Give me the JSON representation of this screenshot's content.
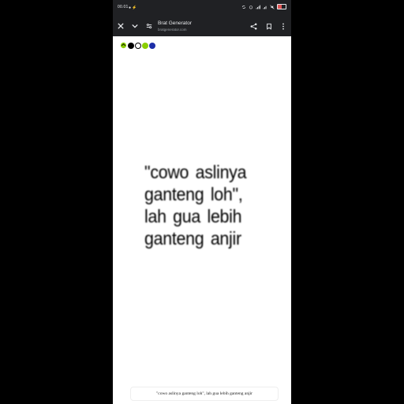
{
  "status_bar": {
    "time": "00.01",
    "indicator_dots": "● ⚡",
    "battery_color": "#e05656"
  },
  "browser": {
    "title": "Brat Generator",
    "url": "bratgenerator.com",
    "icons": [
      "close-icon",
      "chevron-down-icon",
      "tune-icon",
      "share-icon",
      "bookmark-icon",
      "more-vert-icon"
    ]
  },
  "palette": {
    "colors": [
      "#ffffff",
      "#000000",
      "#ffffff",
      "#8ace00",
      "#1d2ea8"
    ]
  },
  "brat_text": {
    "lines": [
      "\"cowo aslinya",
      "ganteng loh\",",
      "lah gua lebih",
      "ganteng anjir"
    ]
  },
  "input": {
    "value": "\"cowo aslinya ganteng loh\", lah gua lebih ganteng anjir"
  }
}
